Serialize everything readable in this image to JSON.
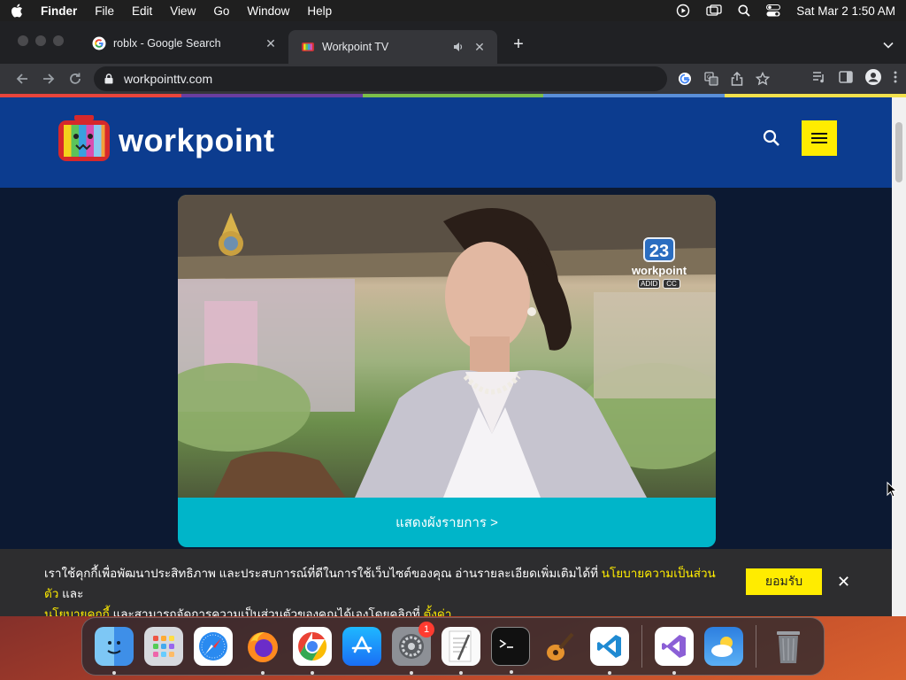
{
  "menubar": {
    "app_name": "Finder",
    "menus": [
      "File",
      "Edit",
      "View",
      "Go",
      "Window",
      "Help"
    ],
    "datetime": "Sat Mar 2  1:50 AM"
  },
  "browser": {
    "tabs": [
      {
        "title": "roblx - Google Search",
        "favicon": "google-icon",
        "active": false
      },
      {
        "title": "Workpoint TV",
        "favicon": "workpoint-icon",
        "active": true,
        "audio": true
      }
    ],
    "url": "workpointtv.com"
  },
  "site": {
    "logo_text": "workpoint",
    "brand_blue": "#0c3c8f",
    "accent_yellow": "#ffec00",
    "schedule_button": "แสดงผังรายการ >",
    "channel_number": "23",
    "channel_name": "workpoint",
    "channel_badges": [
      "ADID",
      "CC"
    ]
  },
  "cookie": {
    "text_1": "เราใช้คุกกี้เพื่อพัฒนาประสิทธิภาพ และประสบการณ์ที่ดีในการใช้เว็บไซต์ของคุณ อ่านรายละเอียดเพิ่มเติมได้ที่ ",
    "link_privacy": "นโยบายความเป็นส่วนตัว",
    "and": " และ",
    "link_cookie": "นโยบายคุกกี้",
    "text_2": " และสามารถจัดการความเป็นส่วนตัวของคุณได้เองโดยคลิกที่ ",
    "link_settings": "ตั้งค่า",
    "accept": "ยอมรับ"
  },
  "dock": {
    "apps": [
      "Finder",
      "Launchpad",
      "Safari",
      "Firefox",
      "Chrome",
      "App Store",
      "System Preferences",
      "TextEdit",
      "Terminal",
      "GarageBand",
      "Visual Studio Code",
      "Visual Studio",
      "Weather",
      "Trash"
    ],
    "system_preferences_badge": "1"
  }
}
